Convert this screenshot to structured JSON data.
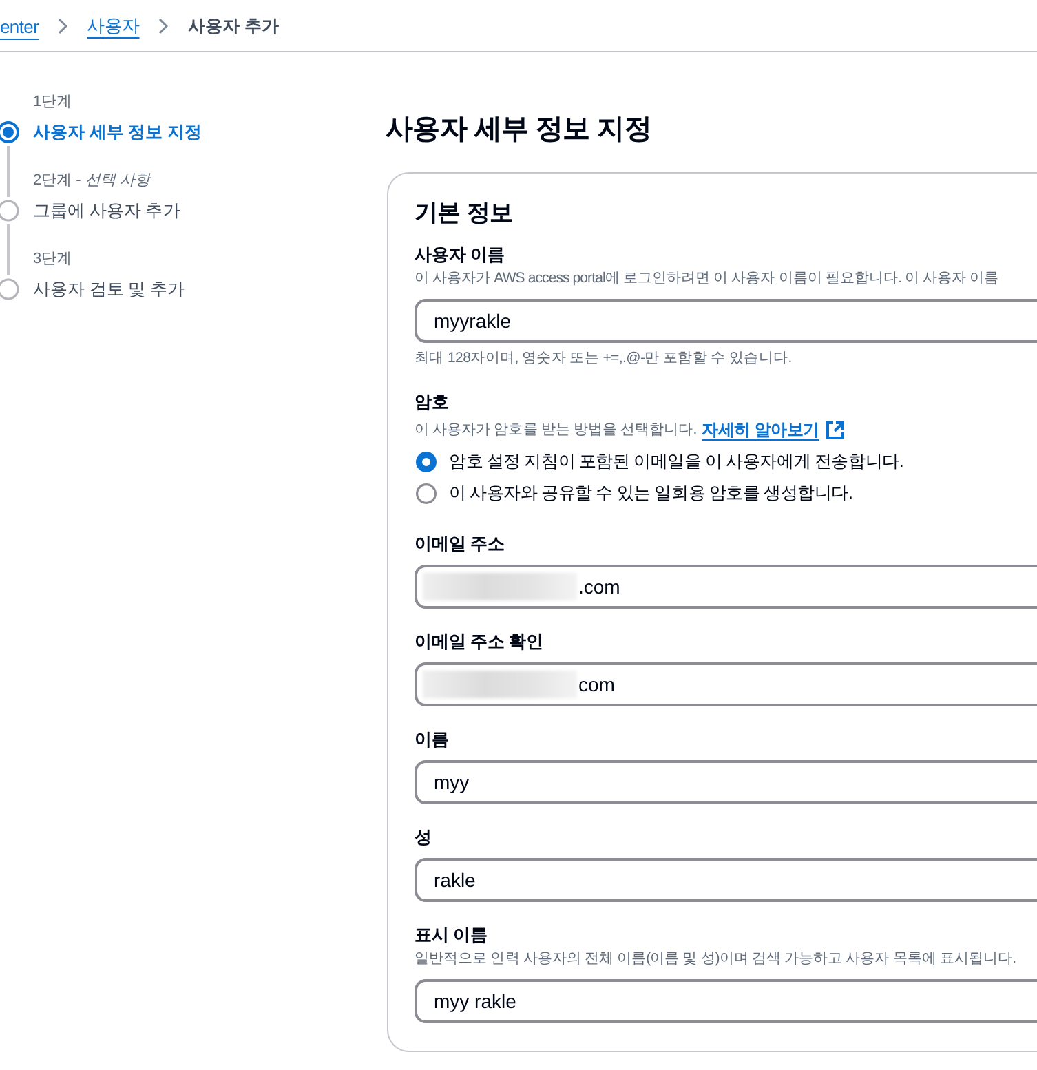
{
  "breadcrumbs": [
    {
      "label": "enter",
      "kind": "link"
    },
    {
      "label": "사용자",
      "kind": "link"
    },
    {
      "label": "사용자 추가",
      "kind": "current"
    }
  ],
  "steps": [
    {
      "number": "1단계",
      "label": "사용자 세부 정보 지정",
      "selected": true
    },
    {
      "number": "2단계 - *선택 사항*",
      "label": "그룹에 사용자 추가",
      "selected": false
    },
    {
      "number": "3단계",
      "label": "사용자 검토 및 추가",
      "selected": false
    }
  ],
  "page_title": "사용자 세부 정보 지정",
  "section": {
    "title": "기본 정보",
    "fields": [
      {
        "kind": "text",
        "label": "사용자 이름",
        "description": "이 사용자가 AWS access portal에 로그인하려면 이 사용자 이름이 필요합니다. 이 사용자 이름",
        "value": "myyrakle",
        "blurred": false,
        "constraint": "최대 128자이며, 영숫자 또는 +=,.@-만 포함할 수 있습니다."
      },
      {
        "kind": "radio",
        "label": "암호",
        "description": "이 사용자가 암호를 받는 방법을 선택합니다.",
        "link": "자세히 알아보기",
        "options": [
          {
            "label": "암호 설정 지침이 포함된 이메일을 이 사용자에게 전송합니다.",
            "selected": true
          },
          {
            "label": "이 사용자와 공유할 수 있는 일회용 암호를 생성합니다.",
            "selected": false
          }
        ]
      },
      {
        "kind": "text",
        "label": "이메일 주소",
        "value": ".com",
        "blurred": true
      },
      {
        "kind": "text",
        "label": "이메일 주소 확인",
        "value": "com",
        "blurred": true
      },
      {
        "kind": "text",
        "label": "이름",
        "value": "myy",
        "blurred": false
      },
      {
        "kind": "text",
        "label": "성",
        "value": "rakle",
        "blurred": false
      },
      {
        "kind": "text",
        "label": "표시 이름",
        "description": "일반적으로 인력 사용자의 전체 이름(이름 및 성)이며 검색 가능하고 사용자 목록에 표시됩니다.",
        "value": "myy rakle",
        "blurred": false
      }
    ]
  }
}
